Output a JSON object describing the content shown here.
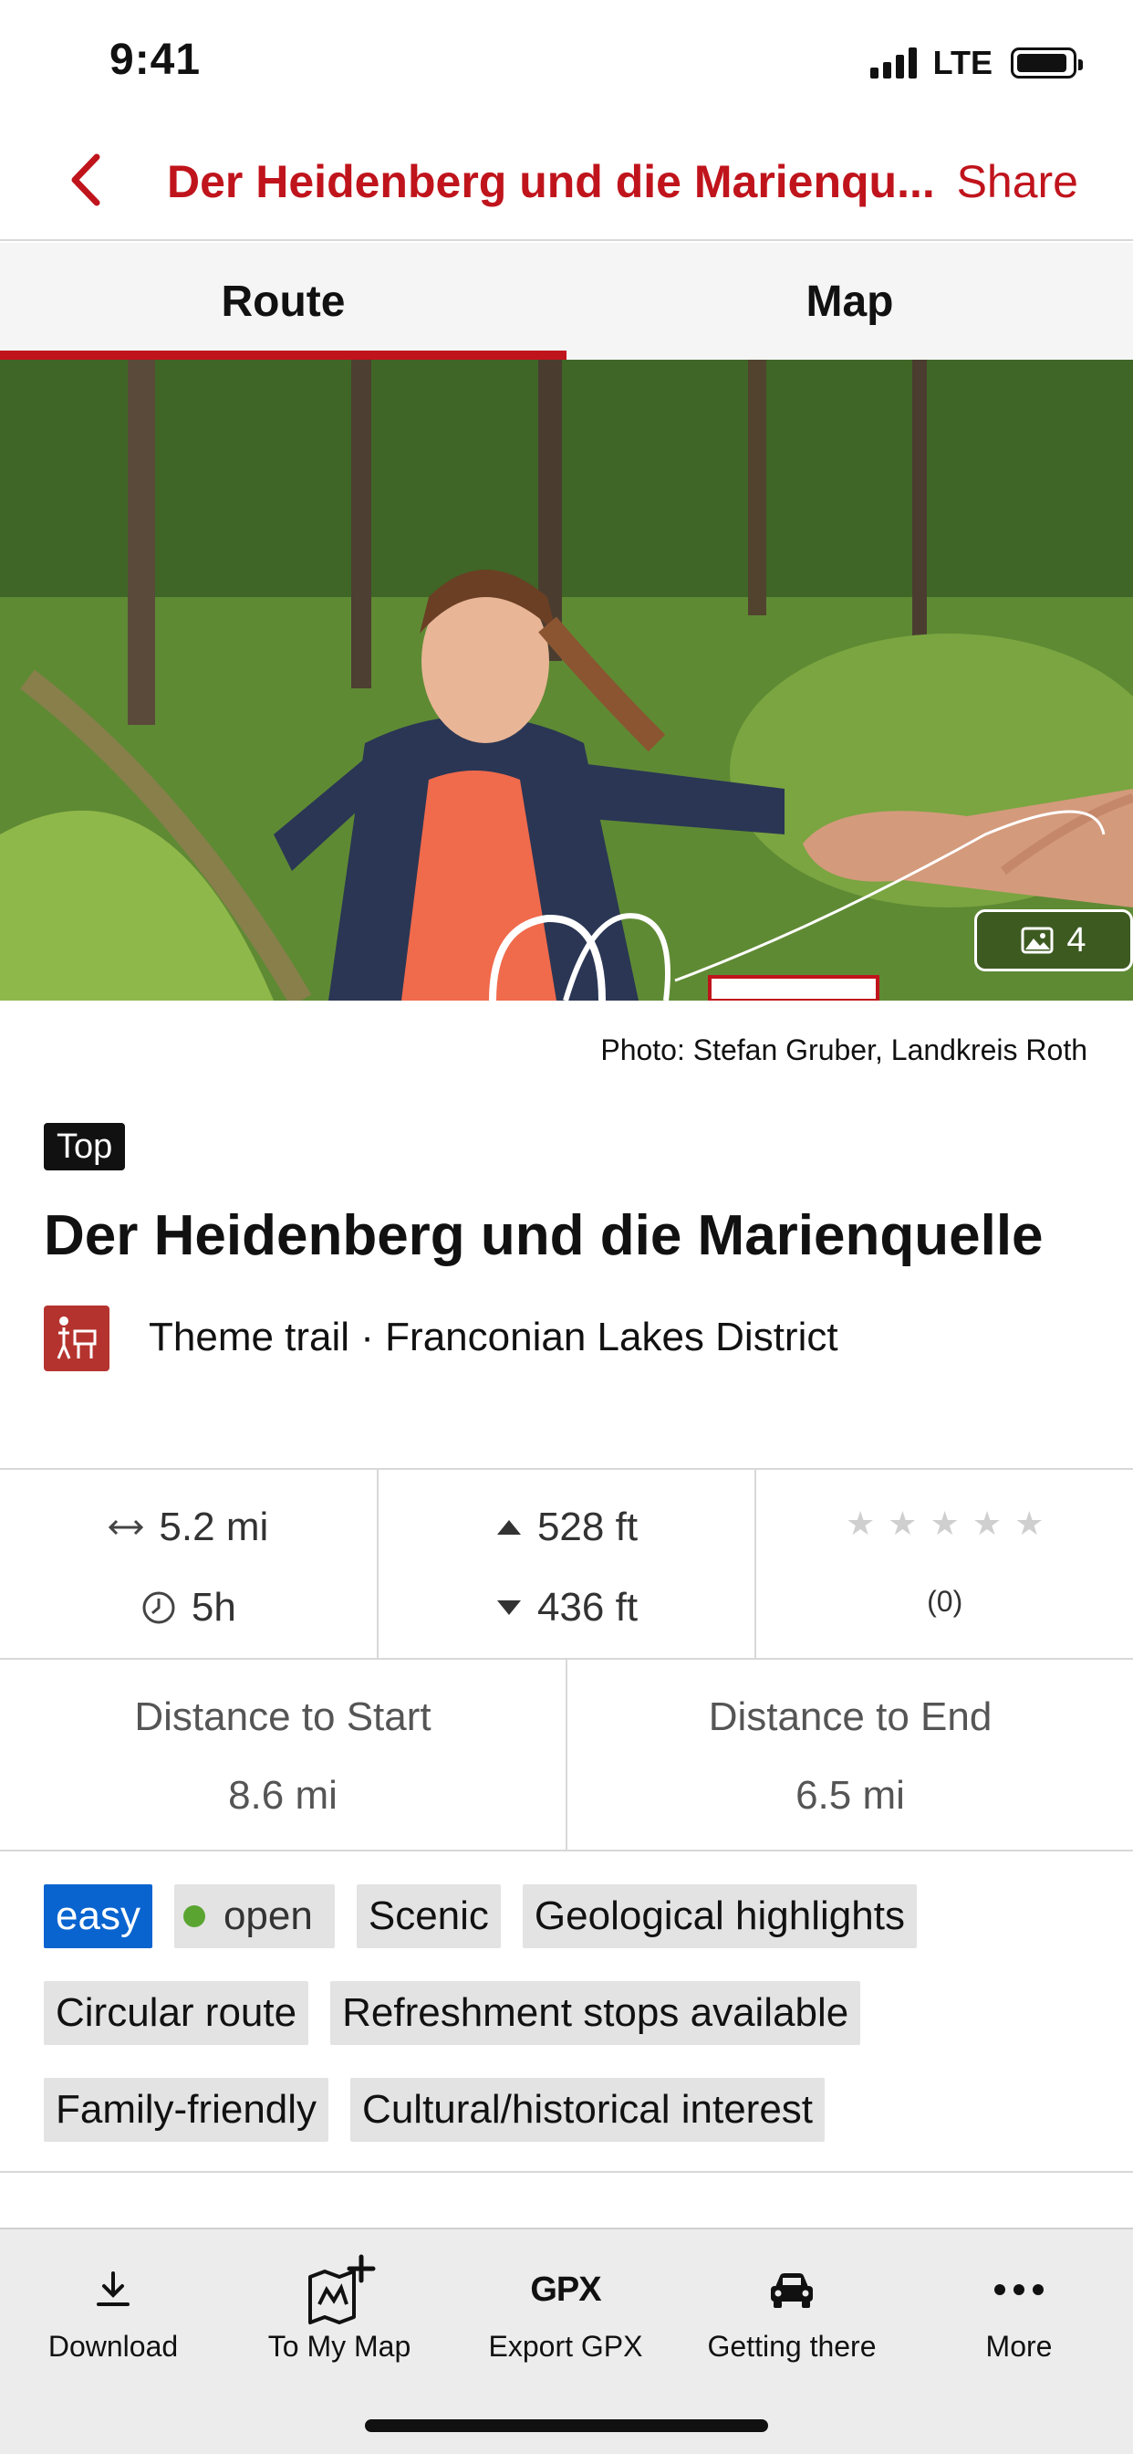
{
  "status_bar": {
    "time": "9:41",
    "network": "LTE"
  },
  "nav": {
    "title": "Der Heidenberg und die Marienqu...",
    "share_label": "Share"
  },
  "tabs": [
    {
      "label": "Route",
      "active": true
    },
    {
      "label": "Map",
      "active": false
    }
  ],
  "hero": {
    "photo_count": "4",
    "photo_credit": "Photo: Stefan Gruber, Landkreis Roth"
  },
  "route": {
    "badge": "Top",
    "title": "Der Heidenberg und die Marienquelle",
    "category": "Theme trail · Franconian Lakes District"
  },
  "stats": {
    "distance": "5.2 mi",
    "duration": "5h",
    "ascent": "528 ft",
    "descent": "436 ft",
    "rating_stars": 0,
    "rating_count": "(0)"
  },
  "distances": {
    "to_start_label": "Distance to Start",
    "to_start_value": "8.6 mi",
    "to_end_label": "Distance to End",
    "to_end_value": "6.5 mi"
  },
  "tags": {
    "difficulty": "easy",
    "status": "open",
    "row1": [
      "Scenic",
      "Geological highlights"
    ],
    "row2": [
      "Circular route",
      "Refreshment stops available"
    ],
    "row3": [
      "Family-friendly",
      "Cultural/historical interest"
    ]
  },
  "toolbar": {
    "download": "Download",
    "to_my_map": "To My Map",
    "export_gpx": "Export GPX",
    "gpx_icon_text": "GPX",
    "getting_there": "Getting there",
    "more": "More"
  },
  "colors": {
    "accent": "#c0141c",
    "easy": "#0a64d0",
    "open_dot": "#5aa531"
  }
}
